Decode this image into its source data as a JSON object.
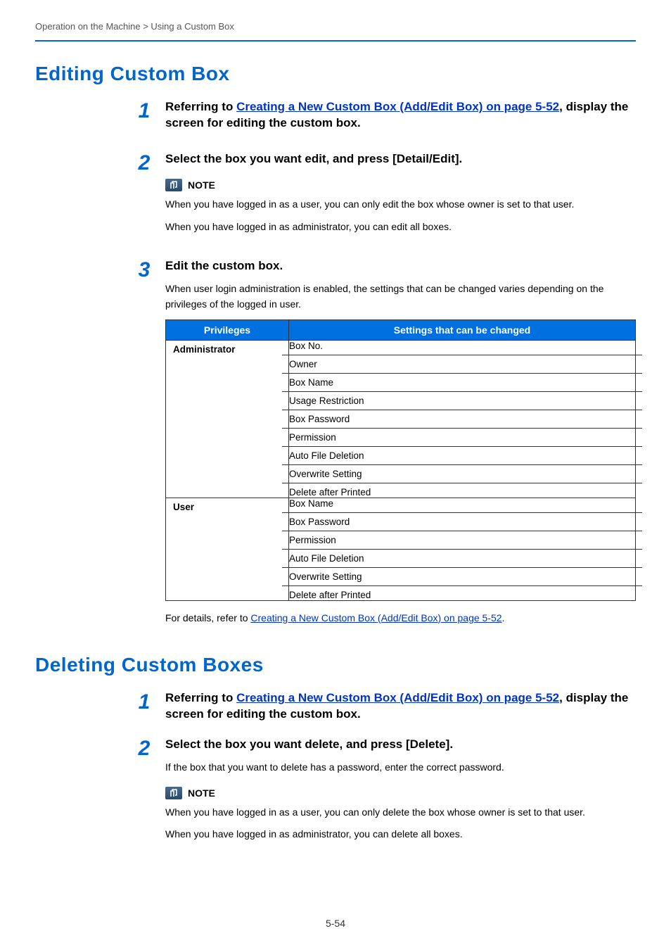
{
  "breadcrumb": "Operation on the Machine > Using a Custom Box",
  "section1": {
    "title": "Editing Custom Box",
    "steps": [
      {
        "num": "1",
        "heading_prefix": "Referring to ",
        "heading_link": "Creating a New Custom Box (Add/Edit Box) on page 5-52",
        "heading_suffix": ", display the screen for editing the custom box."
      },
      {
        "num": "2",
        "heading": "Select the box you want edit, and press [Detail/Edit].",
        "note_label": "NOTE",
        "note_p1": "When you have logged in as a user, you can only edit the box whose owner is set to that user.",
        "note_p2": "When you have logged in as administrator, you can edit all boxes."
      },
      {
        "num": "3",
        "heading": "Edit the custom box.",
        "intro": "When user login administration is enabled, the settings that can be changed varies depending on the privileges of the logged in user.",
        "table_headers": {
          "col1": "Privileges",
          "col2": "Settings that can be changed"
        },
        "table": [
          {
            "role": "Administrator",
            "items": [
              "Box No.",
              "Owner",
              "Box Name",
              "Usage Restriction",
              "Box Password",
              "Permission",
              "Auto File Deletion",
              "Overwrite Setting",
              "Delete after Printed"
            ]
          },
          {
            "role": "User",
            "items": [
              "Box Name",
              "Box Password",
              "Permission",
              "Auto File Deletion",
              "Overwrite Setting",
              "Delete after Printed"
            ]
          }
        ],
        "footer_prefix": "For details, refer to ",
        "footer_link": "Creating a New Custom Box (Add/Edit Box) on page 5-52",
        "footer_suffix": "."
      }
    ]
  },
  "section2": {
    "title": "Deleting Custom Boxes",
    "steps": [
      {
        "num": "1",
        "heading_prefix": "Referring to ",
        "heading_link": "Creating a New Custom Box (Add/Edit Box) on page 5-52",
        "heading_suffix": ", display the screen for editing the custom box."
      },
      {
        "num": "2",
        "heading": "Select the box you want delete, and press [Delete].",
        "body": "If the box that you want to delete has a password, enter the correct password.",
        "note_label": "NOTE",
        "note_p1": "When you have logged in as a user, you can only delete the box whose owner is set to that user.",
        "note_p2": "When you have logged in as administrator, you can delete all boxes."
      }
    ]
  },
  "page_number": "5-54"
}
